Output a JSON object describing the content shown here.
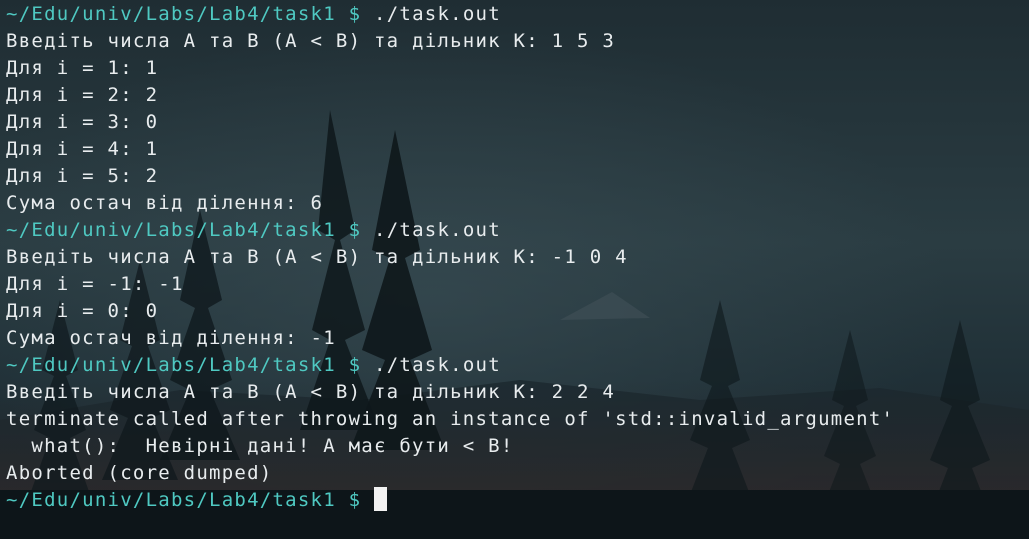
{
  "colors": {
    "text": "#e8ecee",
    "prompt": "#4fc9c2",
    "cursor": "#f2f2f2",
    "background_top": "#25353b",
    "background_bottom": "#0f1a1f"
  },
  "terminal": {
    "prompt_path": "~/Edu/univ/Labs/Lab4/task1",
    "prompt_symbol": "$",
    "blocks": [
      {
        "command": "./task.out",
        "output": [
          "Введіть числа A та B (A < B) та дільник K: 1 5 3",
          "Для i = 1: 1",
          "Для i = 2: 2",
          "Для i = 3: 0",
          "Для i = 4: 1",
          "Для i = 5: 2",
          "Сума остач від ділення: 6"
        ]
      },
      {
        "command": "./task.out",
        "output": [
          "Введіть числа A та B (A < B) та дільник K: -1 0 4",
          "Для i = -1: -1",
          "Для i = 0: 0",
          "Сума остач від ділення: -1"
        ]
      },
      {
        "command": "./task.out",
        "output": [
          "Введіть числа A та B (A < B) та дільник K: 2 2 4",
          "terminate called after throwing an instance of 'std::invalid_argument'",
          "  what():  Невірні дані! A має бути < B!",
          "Aborted (core dumped)"
        ]
      }
    ],
    "current_command": ""
  },
  "wallpaper": {
    "icon": "forest-mountains-wallpaper"
  }
}
